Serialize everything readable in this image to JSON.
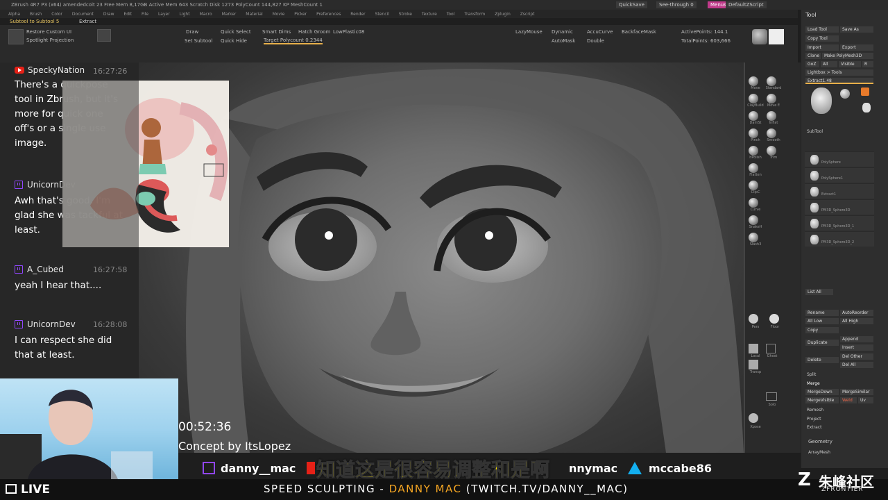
{
  "titlebar": {
    "text": "ZBrush 4R7 P3 (x64)   amendedcolt 23   Free Mem 8,17GB  Active Mem 643  Scratch Disk 1273  PolyCount 144,827 KP  MeshCount 1",
    "quicksave": "QuickSave",
    "seethrough": "See-through  0",
    "menus": "Menus",
    "script": "DefaultZScript"
  },
  "menubar": [
    "Alpha",
    "Brush",
    "Color",
    "Document",
    "Draw",
    "Edit",
    "File",
    "Layer",
    "Light",
    "Macro",
    "Marker",
    "Material",
    "Movie",
    "Picker",
    "Preferences",
    "Render",
    "Stencil",
    "Stroke",
    "Texture",
    "Tool",
    "Transform",
    "Zplugin",
    "Zscript"
  ],
  "subbar": {
    "left": "Subtool to Subtool 5",
    "right": "Extract"
  },
  "toolrow": {
    "restore": "Restore Custom UI",
    "spotlight": "Spotlight Projection",
    "draw": "Draw",
    "quick_select": "Quick Select",
    "smart_dims": "Smart Dims",
    "hatch": "Hatch Groom",
    "low_plastic": "LowPlastic08",
    "set_subtool": "Set Subtool",
    "quick_hide": "Quick Hide",
    "target_poly": "Target Polycount 0.2344",
    "lazy_mouse": "LazyMouse",
    "dynamic": "Dynamic",
    "accucurve": "AccuCurve",
    "backface": "BackfaceMask",
    "automask": "AutoMask",
    "double": "Double",
    "active_points": "ActivePoints: 144.1",
    "total_points": "TotalPoints: 603,666"
  },
  "toolpanel": {
    "title": "Tool",
    "load_tool": "Load Tool",
    "save_as": "Save As",
    "copy_tool": "Copy Tool",
    "import": "Import",
    "export": "Export",
    "clone": "Clone",
    "make_poly": "Make PolyMesh3D",
    "goz": "GoZ",
    "all": "All",
    "visible": "Visible",
    "r": "R",
    "lightbox_tools": "Lightbox > Tools",
    "extract_label": "Extract1.48",
    "subtool": "SubTool",
    "subtool_names": [
      "PolySphere",
      "PolySphere1",
      "Extract1",
      "PM3D_Sphere3D",
      "PM3D_Sphere3D_1",
      "PM3D_Sphere3D_2"
    ],
    "list_all": "List All",
    "rename": "Rename",
    "auto_reorder": "AutoReorder",
    "all_low": "All Low",
    "all_high": "All High",
    "copy": "Copy",
    "duplicate": "Duplicate",
    "append": "Append",
    "insert": "Insert",
    "delete": "Delete",
    "del_other": "Del Other",
    "del_all": "Del All",
    "split": "Split",
    "merge": "Merge",
    "merge_down": "MergeDown",
    "merge_similar": "MergeSimilar",
    "merge_visible": "MergeVisible",
    "weld": "Weld",
    "uv": "Uv",
    "remesh": "Remesh",
    "project": "Project",
    "extract": "Extract",
    "geometry": "Geometry",
    "array_mesh": "ArrayMesh"
  },
  "shelf": {
    "brushes": [
      "Move",
      "Standard",
      "ClayBuild",
      "Move E",
      "DamSt",
      "Inflat",
      "Pinch",
      "Smooth",
      "hPolish",
      "Trim",
      "Flatten",
      "ClipC",
      "Curve",
      "SnakeH",
      "Slash3"
    ],
    "pers": "Pers",
    "floor": "Floor",
    "local": "Local",
    "transp": "Transp",
    "ghost": "Ghost",
    "solo": "Solo",
    "xpose": "Xpose"
  },
  "chat": [
    {
      "platform": "youtube",
      "user": "SpeckyNation",
      "time": "16:27:26",
      "text": "There's a quickpose tool in Zbrush, but it's more for quick one off's or a single use image."
    },
    {
      "platform": "twitch",
      "user": "UnicornDev",
      "time": "",
      "text": "Awh that's good. I'm glad she was tackful at least."
    },
    {
      "platform": "twitch",
      "user": "A_Cubed",
      "time": "16:27:58",
      "text": "yeah I hear that...."
    },
    {
      "platform": "twitch",
      "user": "UnicornDev",
      "time": "16:28:08",
      "text": "I can respect she did that at least."
    }
  ],
  "overlay": {
    "timer": "00:52:36",
    "concept": "Concept by ItsLopez",
    "twitch_name": "danny__mac",
    "youtube_name": "nnymac",
    "artstation_name": "mccabe86",
    "subtitle": "知道这是很容易调整和是啊",
    "live": "LIVE",
    "banner_prefix": "SPEED SCULPTING - ",
    "banner_accent": "DANNY MAC",
    "banner_suffix": " (TWITCH.TV/DANNY__MAC)",
    "watermark": "朱峰社区",
    "watermark_sub": "ZFRONTIER"
  },
  "colors": {
    "twitch": "#9146ff",
    "youtube": "#e62117",
    "artstation": "#13aff0",
    "subtitle": "#ffe500",
    "banner_accent": "#f5a623"
  }
}
